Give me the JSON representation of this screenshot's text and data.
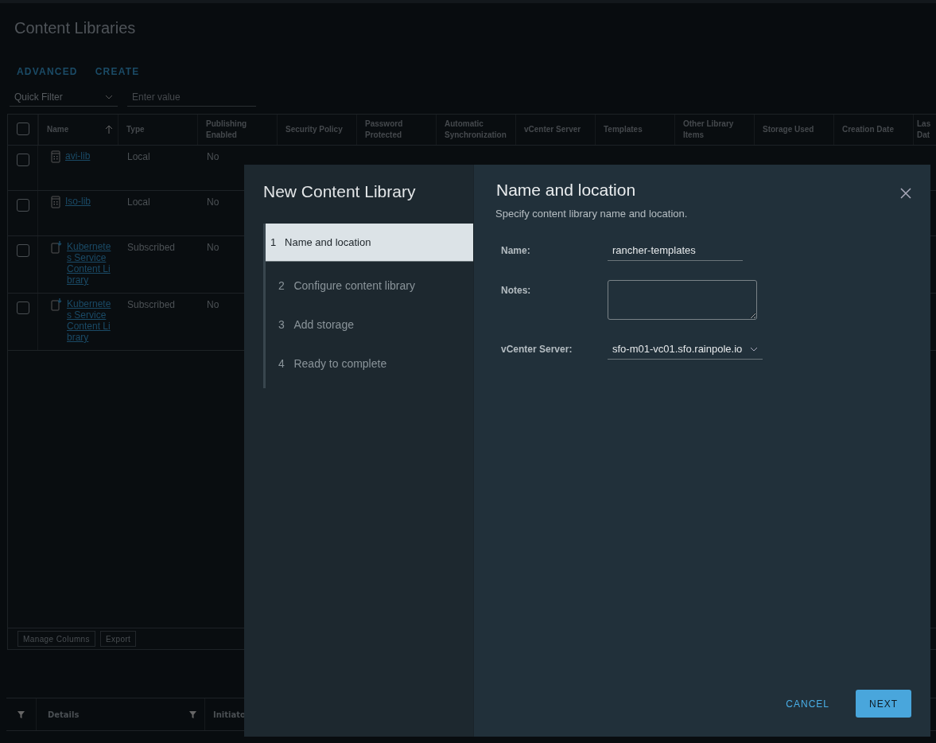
{
  "page": {
    "title": "Content Libraries",
    "actions": [
      "ADVANCED",
      "CREATE"
    ],
    "filter": {
      "value": "Quick Filter",
      "placeholder": "Enter value"
    }
  },
  "table": {
    "select_all": {
      "checked": false
    },
    "columns": [
      "Name",
      "Type",
      "Publishing Enabled",
      "Security Policy",
      "Password Protected",
      "Automatic Synchronization",
      "vCenter Server",
      "Templates",
      "Other Library Items",
      "Storage Used",
      "Creation Date",
      "Las Dat"
    ],
    "rows": [
      {
        "name": "avi-lib",
        "kind": "local",
        "type": "Local",
        "publishing": "No",
        "checked": false
      },
      {
        "name": "Iso-lib",
        "kind": "local",
        "type": "Local",
        "publishing": "No",
        "checked": false
      },
      {
        "name": "Kubernetes Service Content Library",
        "kind": "subscribed",
        "type": "Subscribed",
        "publishing": "No",
        "checked": false
      },
      {
        "name": "Kubernetes Service Content Library",
        "kind": "subscribed",
        "type": "Subscribed",
        "publishing": "No",
        "checked": false
      }
    ],
    "footer_buttons": [
      "Manage Columns",
      "Export"
    ]
  },
  "tasks": {
    "columns": [
      "Details",
      "Initiato"
    ]
  },
  "dialog": {
    "title": "New Content Library",
    "steps": [
      {
        "number": "1",
        "label": "Name and location",
        "selected": true
      },
      {
        "number": "2",
        "label": "Configure content library",
        "selected": false
      },
      {
        "number": "3",
        "label": "Add storage",
        "selected": false
      },
      {
        "number": "4",
        "label": "Ready to complete",
        "selected": false
      }
    ],
    "heading": "Name and location",
    "description": "Specify content library name and location.",
    "fields": [
      {
        "label": "Name:",
        "kind": "text",
        "value": "rancher-templates"
      },
      {
        "label": "Notes:",
        "kind": "textarea"
      },
      {
        "label": "vCenter Server:",
        "kind": "select",
        "value": "sfo-m01-vc01.sfo.rainpole.io"
      }
    ],
    "buttons": [
      {
        "label": "CANCEL",
        "kind": "flat"
      },
      {
        "label": "NEXT",
        "kind": "primary"
      }
    ]
  }
}
